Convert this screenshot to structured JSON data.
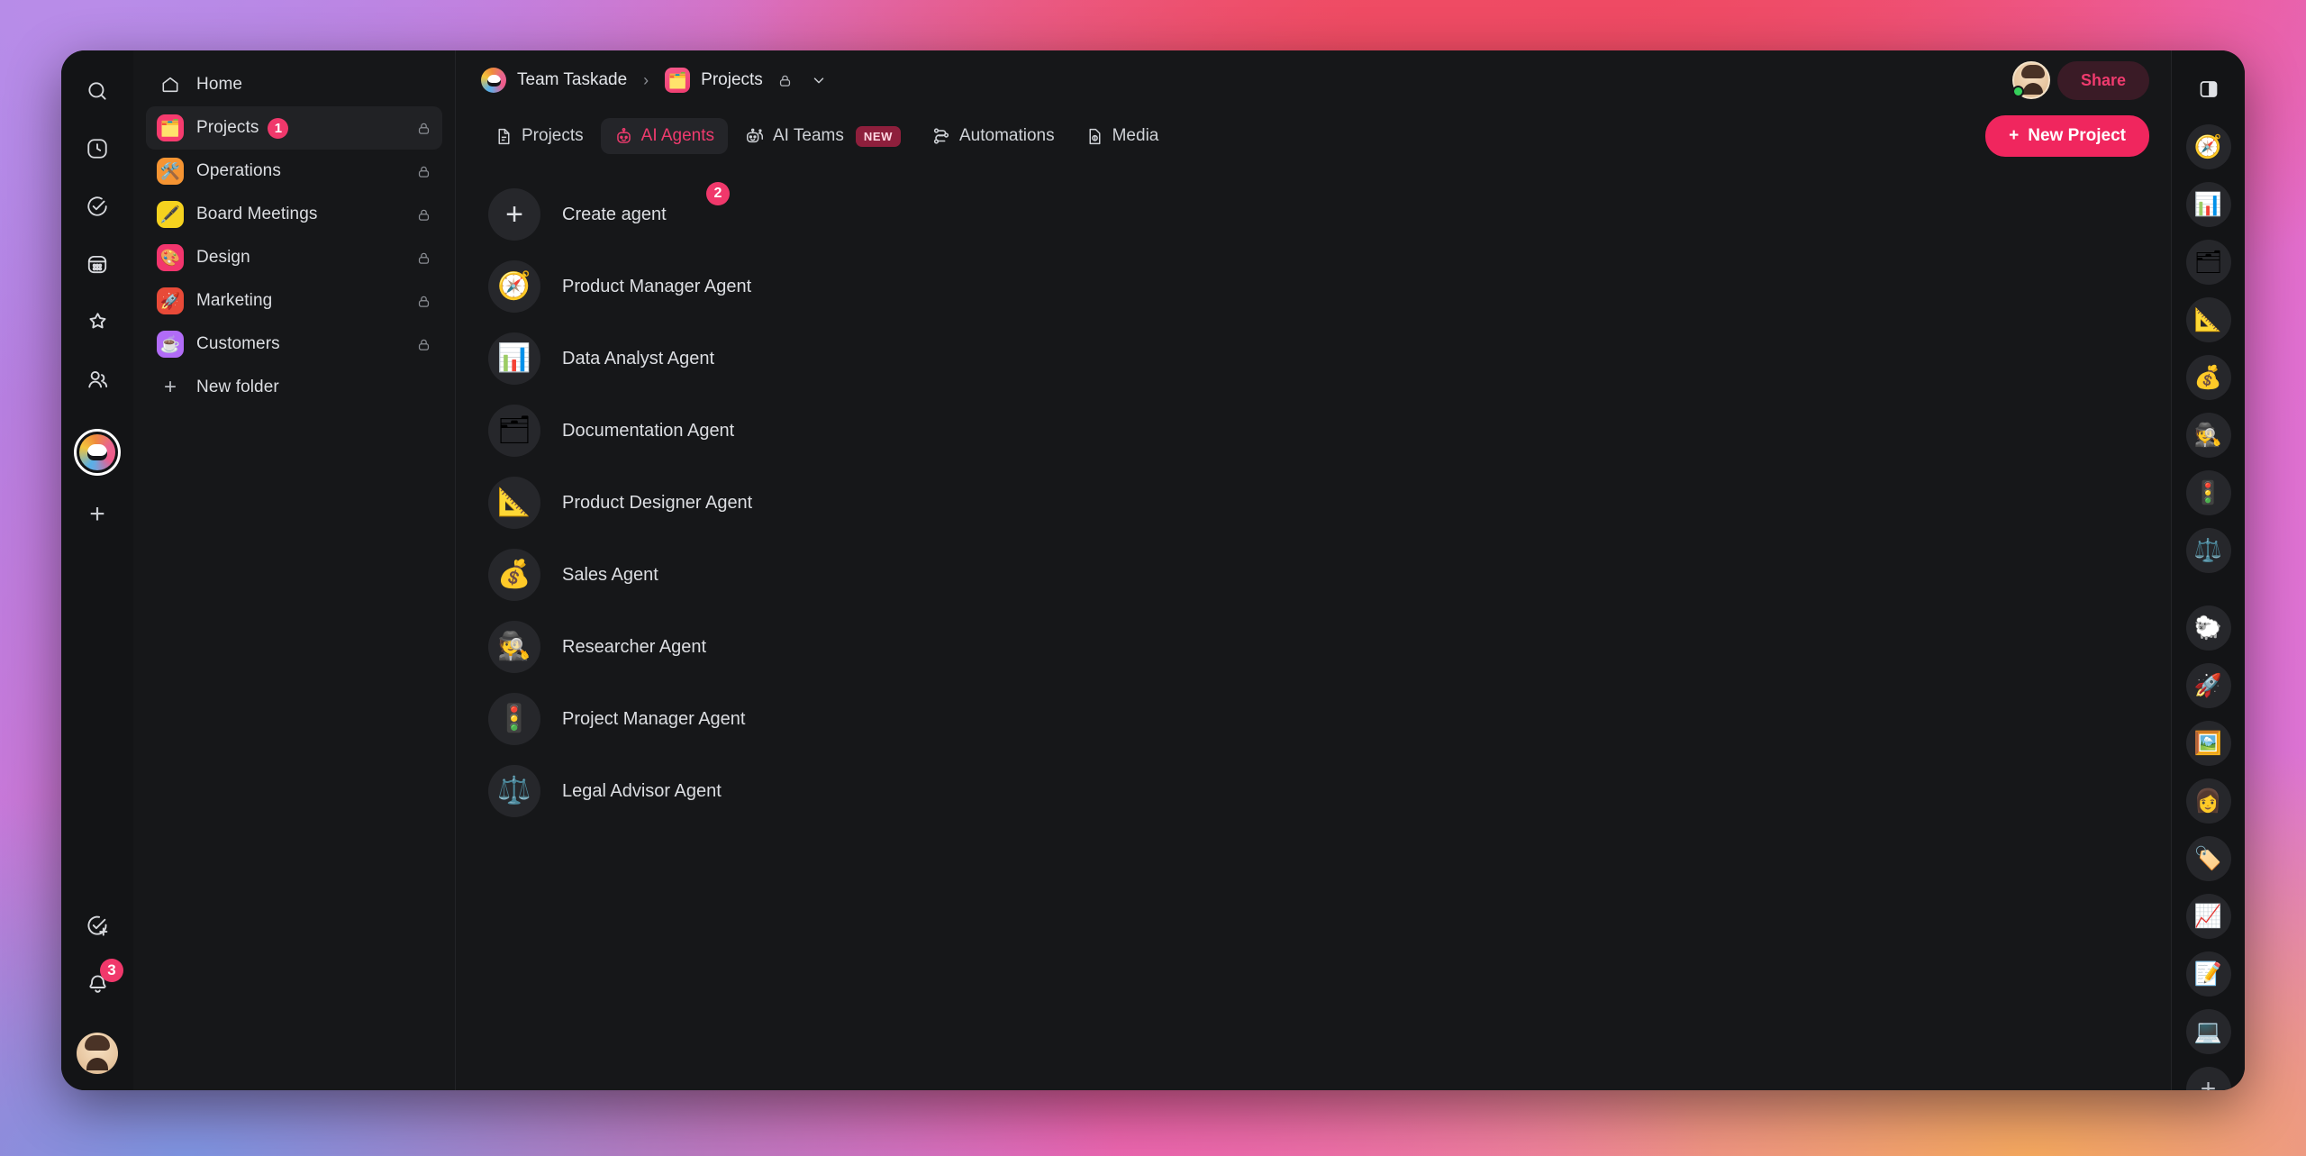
{
  "window": {
    "background_accents": [
      "#a98ae8",
      "#ef4f63",
      "#e06fd0",
      "#7d93e0",
      "#f5a85e"
    ],
    "panel_bg": "#161719",
    "accent": "#ef3b6e"
  },
  "icon_rail": {
    "items": [
      {
        "name": "search-icon",
        "label": "Search"
      },
      {
        "name": "recent-clock-icon",
        "label": "Recent"
      },
      {
        "name": "tasks-check-icon",
        "label": "Tasks"
      },
      {
        "name": "calendar-icon",
        "label": "Calendar"
      },
      {
        "name": "favorites-star-icon",
        "label": "Favorites"
      },
      {
        "name": "people-icon",
        "label": "People"
      }
    ],
    "workspace_logo_label": "Team Taskade",
    "add_workspace_label": "+",
    "bottom": {
      "add_task_label": "Add task",
      "notifications_label": "Notifications",
      "notifications_count": "3",
      "avatar_label": "Account"
    }
  },
  "sidebar": {
    "home": {
      "label": "Home",
      "icon": "home-icon"
    },
    "folders": [
      {
        "label": "Projects",
        "emoji": "🗂️",
        "bg": "#f63b6e",
        "count": "1",
        "locked": true,
        "active": true
      },
      {
        "label": "Operations",
        "emoji": "🛠️",
        "bg": "#f59432",
        "count": null,
        "locked": true,
        "active": false
      },
      {
        "label": "Board Meetings",
        "emoji": "🖋️",
        "bg": "#f5d21f",
        "count": null,
        "locked": true,
        "active": false
      },
      {
        "label": "Design",
        "emoji": "🎨",
        "bg": "#f2356d",
        "count": null,
        "locked": true,
        "active": false
      },
      {
        "label": "Marketing",
        "emoji": "🚀",
        "bg": "#e84a38",
        "count": null,
        "locked": true,
        "active": false
      },
      {
        "label": "Customers",
        "emoji": "☕",
        "bg": "#b16cf7",
        "count": null,
        "locked": true,
        "active": false
      }
    ],
    "new_folder_label": "New folder"
  },
  "header": {
    "breadcrumb": {
      "workspace": "Team Taskade",
      "separator": "›",
      "project": "Projects",
      "project_emoji": "🗂️",
      "locked": true
    },
    "share_label": "Share",
    "panel_toggle_icon": "panel-layout-icon"
  },
  "tabs": {
    "items": [
      {
        "label": "Projects",
        "icon": "document-icon",
        "active": false,
        "badge": null
      },
      {
        "label": "AI Agents",
        "icon": "robot-icon",
        "active": true,
        "badge": null
      },
      {
        "label": "AI Teams",
        "icon": "robots-icon",
        "active": false,
        "badge": "NEW"
      },
      {
        "label": "Automations",
        "icon": "flow-icon",
        "active": false,
        "badge": null
      },
      {
        "label": "Media",
        "icon": "media-icon",
        "active": false,
        "badge": null
      }
    ],
    "new_project_label": "New Project"
  },
  "agents": {
    "create": {
      "label": "Create agent",
      "icon": "plus-icon",
      "badge": "2"
    },
    "items": [
      {
        "label": "Product Manager Agent",
        "emoji": "🧭"
      },
      {
        "label": "Data Analyst Agent",
        "emoji": "📊"
      },
      {
        "label": "Documentation Agent",
        "emoji": "🗂"
      },
      {
        "label": "Product Designer Agent",
        "emoji": "📐"
      },
      {
        "label": "Sales Agent",
        "emoji": "💰"
      },
      {
        "label": "Researcher Agent",
        "emoji": "🕵️"
      },
      {
        "label": "Project Manager Agent",
        "emoji": "🚦"
      },
      {
        "label": "Legal Advisor Agent",
        "emoji": "⚖️"
      }
    ]
  },
  "right_rail": {
    "top_icon": "panel-layout-icon",
    "items": [
      {
        "emoji": "🧭",
        "name": "product-manager-agent-icon"
      },
      {
        "emoji": "📊",
        "name": "data-analyst-agent-icon"
      },
      {
        "emoji": "🗂",
        "name": "documentation-agent-icon"
      },
      {
        "emoji": "📐",
        "name": "product-designer-agent-icon"
      },
      {
        "emoji": "💰",
        "name": "sales-agent-icon"
      },
      {
        "emoji": "🕵️",
        "name": "researcher-agent-icon"
      },
      {
        "emoji": "🚦",
        "name": "project-manager-agent-icon"
      },
      {
        "emoji": "⚖️",
        "name": "legal-advisor-agent-icon"
      }
    ],
    "items_lower": [
      {
        "emoji": "🐑",
        "name": "sheep-icon"
      },
      {
        "emoji": "🚀",
        "name": "rocket-icon"
      },
      {
        "emoji": "🖼️",
        "name": "framed-picture-icon"
      },
      {
        "emoji": "👩",
        "name": "person-icon"
      },
      {
        "emoji": "🏷️",
        "name": "label-icon"
      },
      {
        "emoji": "📈",
        "name": "chart-increasing-icon"
      },
      {
        "emoji": "📝",
        "name": "memo-icon"
      },
      {
        "emoji": "💻",
        "name": "laptop-icon"
      }
    ],
    "add_label": "+"
  }
}
